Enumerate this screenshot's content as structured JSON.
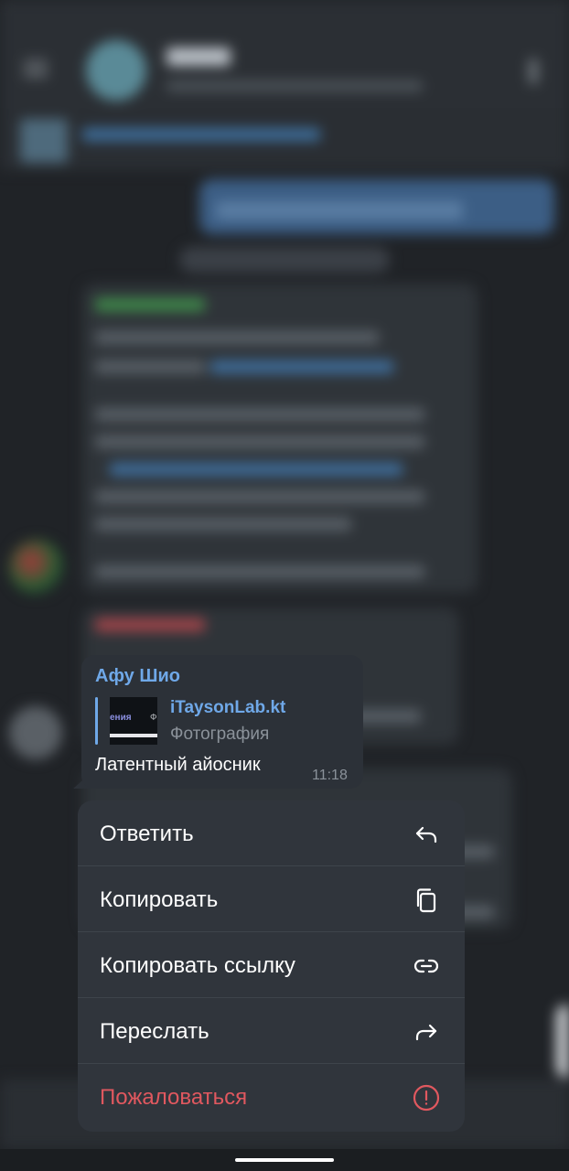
{
  "message": {
    "author": "Афу Шио",
    "reply": {
      "title": "iTaysonLab.kt",
      "subtitle": "Фотография",
      "thumb_text_left": "ения",
      "thumb_text_right": "Ф"
    },
    "text": "Латентный айосник",
    "time": "11:18"
  },
  "context_menu": {
    "items": [
      {
        "label": "Ответить",
        "icon": "reply-icon"
      },
      {
        "label": "Копировать",
        "icon": "copy-icon"
      },
      {
        "label": "Копировать ссылку",
        "icon": "link-icon"
      },
      {
        "label": "Переслать",
        "icon": "forward-icon"
      },
      {
        "label": "Пожаловаться",
        "icon": "report-icon",
        "color": "#e0585f"
      }
    ]
  },
  "colors": {
    "accent": "#6fa8e8",
    "danger": "#e0585f",
    "menu_bg": "#30353c",
    "bubble_bg": "#2c3138",
    "backdrop": "#202327"
  }
}
